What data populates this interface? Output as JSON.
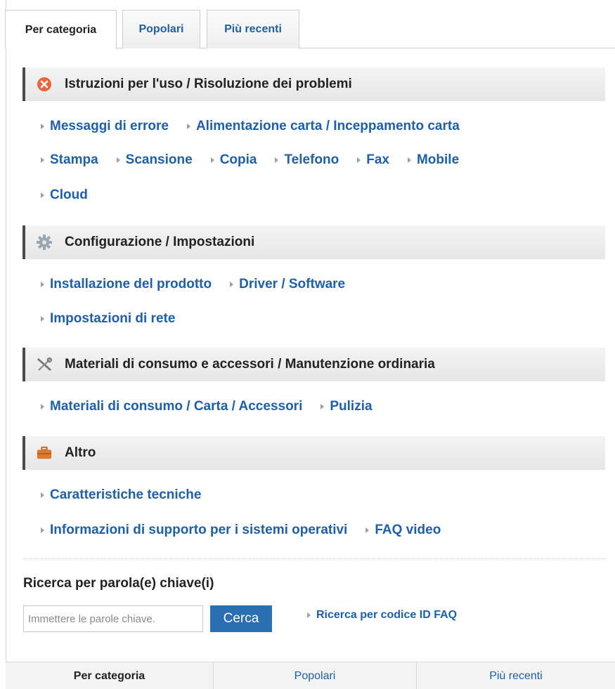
{
  "tabs": [
    {
      "label": "Per categoria",
      "active": true
    },
    {
      "label": "Popolari",
      "active": false
    },
    {
      "label": "Più recenti",
      "active": false
    }
  ],
  "sections": [
    {
      "title": "Istruzioni per l'uso / Risoluzione dei problemi",
      "icon": "error-x-icon",
      "icon_color": "#e8663a",
      "rows": [
        [
          "Messaggi di errore",
          "Alimentazione carta / Inceppamento carta"
        ],
        [
          "Stampa",
          "Scansione",
          "Copia",
          "Telefono",
          "Fax",
          "Mobile"
        ],
        [
          "Cloud"
        ]
      ]
    },
    {
      "title": "Configurazione / Impostazioni",
      "icon": "gear-icon",
      "icon_color": "#9aa7b3",
      "rows": [
        [
          "Installazione del prodotto",
          "Driver / Software"
        ],
        [
          "Impostazioni di rete"
        ]
      ]
    },
    {
      "title": "Materiali di consumo e accessori / Manutenzione ordinaria",
      "icon": "tools-icon",
      "icon_color": "#777777",
      "rows": [
        [
          "Materiali di consumo / Carta / Accessori",
          "Pulizia"
        ]
      ]
    },
    {
      "title": "Altro",
      "icon": "briefcase-icon",
      "icon_color": "#e07a2a",
      "rows": [
        [
          "Caratteristiche tecniche"
        ],
        [
          "Informazioni di supporto per i sistemi operativi",
          "FAQ video"
        ]
      ]
    }
  ],
  "search": {
    "title": "Ricerca per parola(e) chiave(i)",
    "placeholder": "Immettere le parole chiave.",
    "button_label": "Cerca",
    "faq_id_link": "Ricerca per codice ID FAQ"
  },
  "bottom_tabs": [
    {
      "label": "Per categoria",
      "active": true
    },
    {
      "label": "Popolari",
      "active": false
    },
    {
      "label": "Più recenti",
      "active": false
    }
  ],
  "colors": {
    "link": "#1f5fa8",
    "button": "#2a6eb3"
  }
}
